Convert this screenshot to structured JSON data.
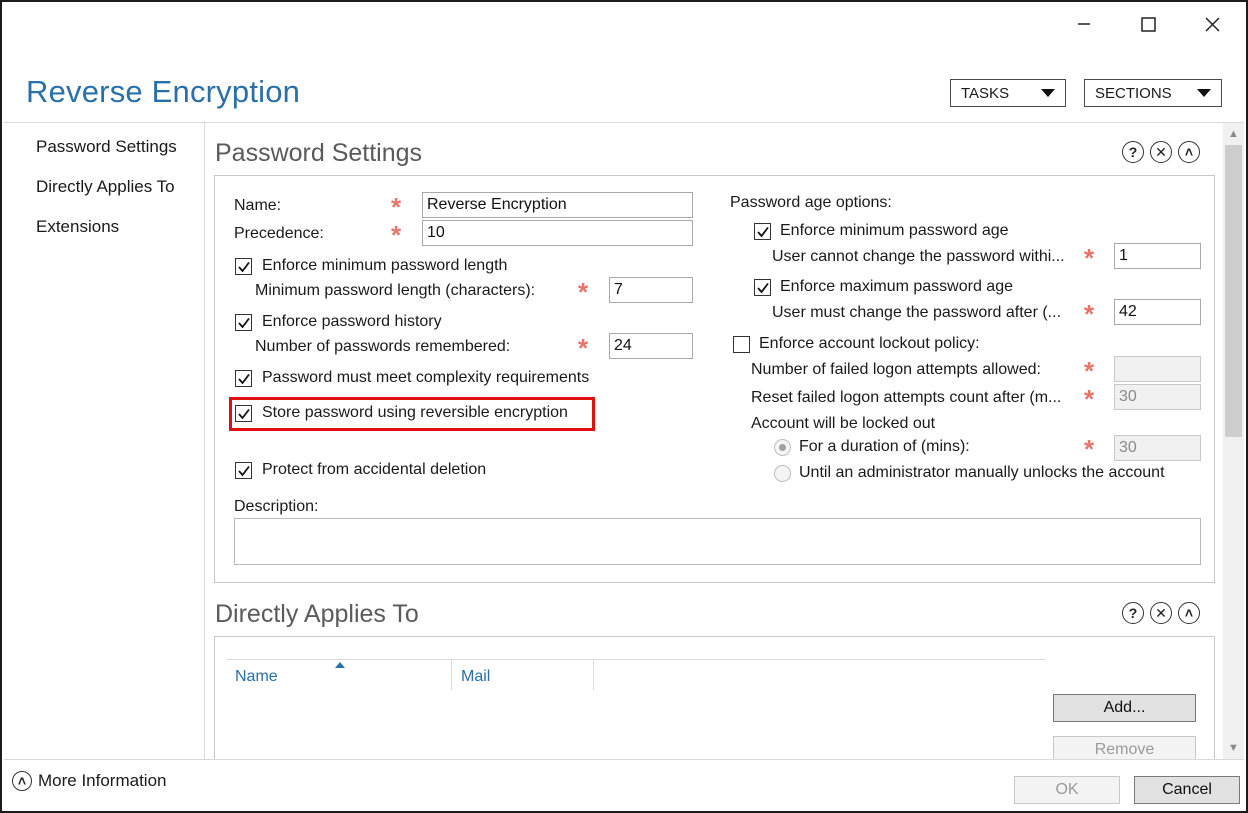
{
  "window": {
    "title": "Reverse Encryption",
    "controls": {
      "minimize": "minimize-icon",
      "maximize": "maximize-icon",
      "close": "close-icon"
    }
  },
  "header": {
    "tasks_label": "TASKS",
    "sections_label": "SECTIONS"
  },
  "nav": {
    "items": [
      {
        "label": "Password Settings"
      },
      {
        "label": "Directly Applies To"
      },
      {
        "label": "Extensions"
      }
    ]
  },
  "password_settings": {
    "title": "Password Settings",
    "name_label": "Name:",
    "name_value": "Reverse Encryption",
    "precedence_label": "Precedence:",
    "precedence_value": "10",
    "enforce_min_length_label": "Enforce minimum password length",
    "enforce_min_length_checked": true,
    "min_length_label": "Minimum password length (characters):",
    "min_length_value": "7",
    "enforce_history_label": "Enforce password history",
    "enforce_history_checked": true,
    "history_label": "Number of passwords remembered:",
    "history_value": "24",
    "complexity_label": "Password must meet complexity requirements",
    "complexity_checked": true,
    "reversible_label": "Store password using reversible encryption",
    "reversible_checked": true,
    "protect_label": "Protect from accidental deletion",
    "protect_checked": true,
    "description_label": "Description:",
    "description_value": "",
    "age_options_label": "Password age options:",
    "enforce_min_age_label": "Enforce minimum password age",
    "enforce_min_age_checked": true,
    "min_age_label": "User cannot change the password withi...",
    "min_age_value": "1",
    "enforce_max_age_label": "Enforce maximum password age",
    "enforce_max_age_checked": true,
    "max_age_label": "User must change the password after (...",
    "max_age_value": "42",
    "lockout_label": "Enforce account lockout policy:",
    "lockout_checked": false,
    "failed_attempts_label": "Number of failed logon attempts allowed:",
    "failed_attempts_value": "",
    "reset_label": "Reset failed logon attempts count after (m...",
    "reset_value": "30",
    "locked_out_label": "Account will be locked out",
    "duration_label": "For a duration of (mins):",
    "duration_value": "30",
    "until_admin_label": "Until an administrator manually unlocks the account"
  },
  "directly_applies_to": {
    "title": "Directly Applies To",
    "columns": [
      "Name",
      "Mail"
    ],
    "rows": [],
    "add_label": "Add...",
    "remove_label": "Remove"
  },
  "footer": {
    "more_info_label": "More Information",
    "ok_label": "OK",
    "cancel_label": "Cancel"
  },
  "colors": {
    "accent": "#2a6fa8",
    "required_star": "#e8746a",
    "highlight": "#e01010"
  }
}
